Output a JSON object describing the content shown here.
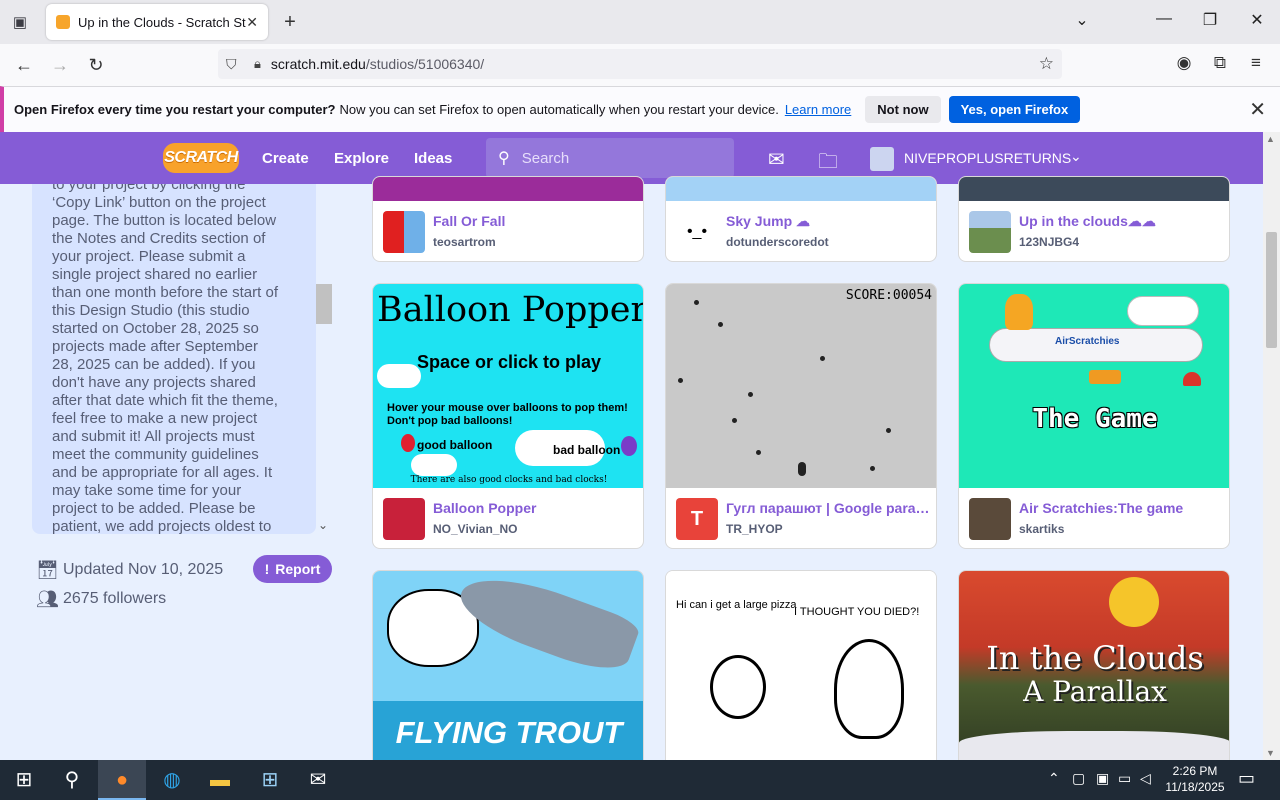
{
  "browser": {
    "tab_title": "Up in the Clouds - Scratch Studi",
    "url_host": "scratch.mit.edu",
    "url_path": "/studios/51006340/"
  },
  "notification": {
    "bold": "Open Firefox every time you restart your computer?",
    "text": "Now you can set Firefox to open automatically when you restart your device.",
    "learn_more": "Learn more",
    "not_now": "Not now",
    "yes": "Yes, open Firefox"
  },
  "header": {
    "logo": "SCRATCH",
    "create": "Create",
    "explore": "Explore",
    "ideas": "Ideas",
    "search_placeholder": "Search",
    "username": "NIVEPROPLUSRETURNS"
  },
  "studio": {
    "description": "to your project by clicking the\n‘Copy Link’ button on the project\npage. The button is located below\nthe Notes and Credits section of\nyour project. Please submit a\nsingle project shared no earlier\nthan one month before the start of\nthis Design Studio (this studio\nstarted on October 28, 2025 so\nprojects made after September\n28, 2025 can be added). If you\ndon't have any projects shared\nafter that date which fit the theme,\nfeel free to make a new project\nand submit it! All projects must\nmeet the community guidelines\nand be appropriate for all ages. It\nmay take some time for your\nproject to be added. Please be\npatient, we add projects oldest to",
    "updated": "Updated Nov 10, 2025",
    "followers": "2675 followers",
    "report": "Report"
  },
  "projects": [
    {
      "title": "Fall Or Fall",
      "author": "teosartrom"
    },
    {
      "title": "Sky Jump ☁",
      "author": "dotunderscoredot"
    },
    {
      "title": "Up in the clouds☁☁",
      "author": "123NJBG4"
    },
    {
      "title": "Balloon Popper",
      "author": "NO_Vivian_NO"
    },
    {
      "title": "Гугл парашют | Google parachute",
      "author": "TR_HYOP"
    },
    {
      "title": "Air Scratchies:The game",
      "author": "skartiks"
    }
  ],
  "thumbnails": {
    "balloon_title": "Balloon Popper!",
    "balloon_sub": "Space or click to play",
    "balloon_hint1": "Hover your mouse over balloons to pop them!",
    "balloon_hint2": "Don't pop bad balloons!",
    "good": "good balloon",
    "bad": "bad balloon",
    "clocks": "There are also good clocks and bad clocks!",
    "score": "SCORE:00054",
    "airscratchies_brand": "AirScratchies",
    "air_game": "The Game",
    "trout": "FLYING TROUT",
    "pizza1": "Hi can i get a large pizza",
    "pizza2": "I THOUGHT YOU DIED?!",
    "parallax1": "In the Clouds",
    "parallax2": "A Parallax"
  },
  "taskbar": {
    "time": "2:26 PM",
    "date": "11/18/2025"
  }
}
